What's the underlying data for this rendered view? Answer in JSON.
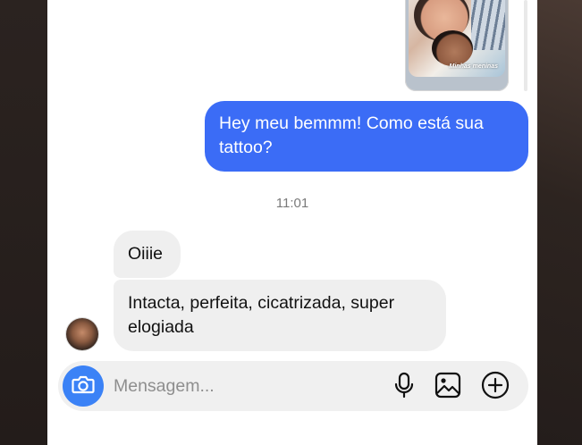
{
  "thread": {
    "shared_photo": {
      "caption": "Minhas meninas",
      "icon": "photo-thumbnail"
    },
    "outgoing_message": "Hey meu bemmm! Como está sua tattoo?",
    "timestamp": "11:01",
    "incoming_messages": [
      "Oiiie",
      "Intacta, perfeita, cicatrizada, super elogiada"
    ],
    "sender_avatar": "contact-avatar"
  },
  "composer": {
    "placeholder": "Mensagem...",
    "value": "",
    "camera_icon": "camera-icon",
    "mic_icon": "microphone-icon",
    "gallery_icon": "gallery-icon",
    "add_icon": "plus-circle-icon"
  },
  "colors": {
    "outgoing_bubble": "#3b6cf6",
    "incoming_bubble": "#efefef",
    "camera_button": "#3b82f6",
    "composer_bg": "#f0f0f0"
  }
}
